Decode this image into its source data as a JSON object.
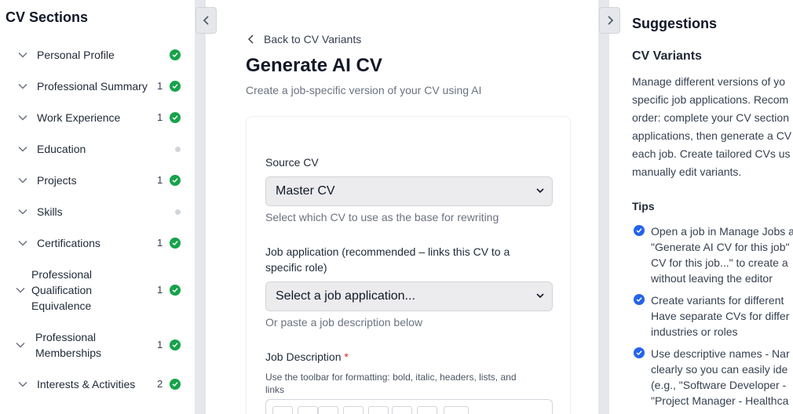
{
  "left": {
    "title": "CV Sections",
    "sections": [
      {
        "lines": [
          "Personal Profile"
        ],
        "count": "",
        "status": "complete"
      },
      {
        "lines": [
          "Professional Summary"
        ],
        "count": "1",
        "status": "complete"
      },
      {
        "lines": [
          "Work Experience"
        ],
        "count": "1",
        "status": "complete"
      },
      {
        "lines": [
          "Education"
        ],
        "count": "",
        "status": "empty"
      },
      {
        "lines": [
          "Projects"
        ],
        "count": "1",
        "status": "complete"
      },
      {
        "lines": [
          "Skills"
        ],
        "count": "",
        "status": "empty"
      },
      {
        "lines": [
          "Certifications"
        ],
        "count": "1",
        "status": "complete"
      },
      {
        "lines": [
          "Professional",
          "Qualification",
          "Equivalence"
        ],
        "count": "1",
        "status": "complete"
      },
      {
        "lines": [
          "Professional",
          "Memberships"
        ],
        "count": "1",
        "status": "complete"
      },
      {
        "lines": [
          "Interests & Activities"
        ],
        "count": "2",
        "status": "complete"
      }
    ]
  },
  "main": {
    "back_label": "Back to CV Variants",
    "title": "Generate AI CV",
    "subtitle": "Create a job-specific version of your CV using AI",
    "source_label": "Source CV",
    "source_value": "Master CV",
    "source_help": "Select which CV to use as the base for rewriting",
    "job_label_line1": "Job application (recommended – links this CV to a",
    "job_label_line2": "specific role)",
    "job_value": "Select a job application...",
    "job_help": "Or paste a job description below",
    "desc_label": "Job Description",
    "desc_required": "*",
    "desc_help_line1": "Use the toolbar for formatting: bold, italic, headers, lists, and",
    "desc_help_line2": "links"
  },
  "right": {
    "title": "Suggestions",
    "subtitle": "CV Variants",
    "paragraph": [
      "Manage different versions of yo",
      "specific job applications. Recom",
      "order: complete your CV section",
      "applications, then generate a CV",
      "each job. Create tailored CVs us",
      "manually edit variants."
    ],
    "tips_title": "Tips",
    "tips": [
      [
        "Open a job in Manage Jobs a",
        "\"Generate AI CV for this job\"",
        "CV for this job...\" to create a",
        "without leaving the editor"
      ],
      [
        "Create variants for different",
        "Have separate CVs for differ",
        "industries or roles"
      ],
      [
        "Use descriptive names - Nar",
        "clearly so you can easily ide",
        "(e.g., \"Software Developer -",
        "\"Project Manager - Healthca"
      ]
    ]
  },
  "colors": {
    "success": "#16a34a",
    "info": "#2563eb",
    "required": "#dc2626"
  }
}
